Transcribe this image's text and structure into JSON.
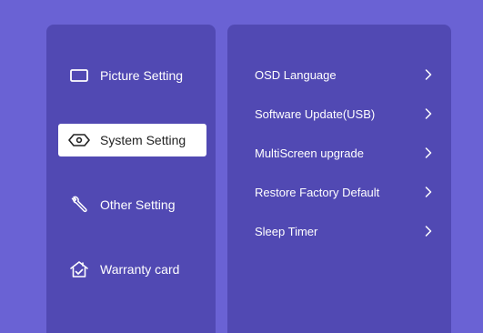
{
  "colors": {
    "background": "#6a62d4",
    "panel": "#5149b3",
    "selected_bg": "#ffffff",
    "selected_text": "#222222",
    "text": "#ffffff"
  },
  "sidebar": {
    "items": [
      {
        "label": "Picture Setting",
        "icon": "picture-frame-icon",
        "selected": false
      },
      {
        "label": "System Setting",
        "icon": "system-eye-icon",
        "selected": true
      },
      {
        "label": "Other Setting",
        "icon": "wrench-icon",
        "selected": false
      },
      {
        "label": "Warranty card",
        "icon": "house-check-icon",
        "selected": false
      }
    ]
  },
  "system_menu": {
    "options": [
      {
        "label": "OSD Language",
        "icon": "chevron-right-icon"
      },
      {
        "label": "Software Update(USB)",
        "icon": "chevron-right-icon"
      },
      {
        "label": "MultiScreen upgrade",
        "icon": "chevron-right-icon"
      },
      {
        "label": "Restore Factory Default",
        "icon": "chevron-right-icon"
      },
      {
        "label": "Sleep Timer",
        "icon": "chevron-right-icon"
      }
    ]
  }
}
